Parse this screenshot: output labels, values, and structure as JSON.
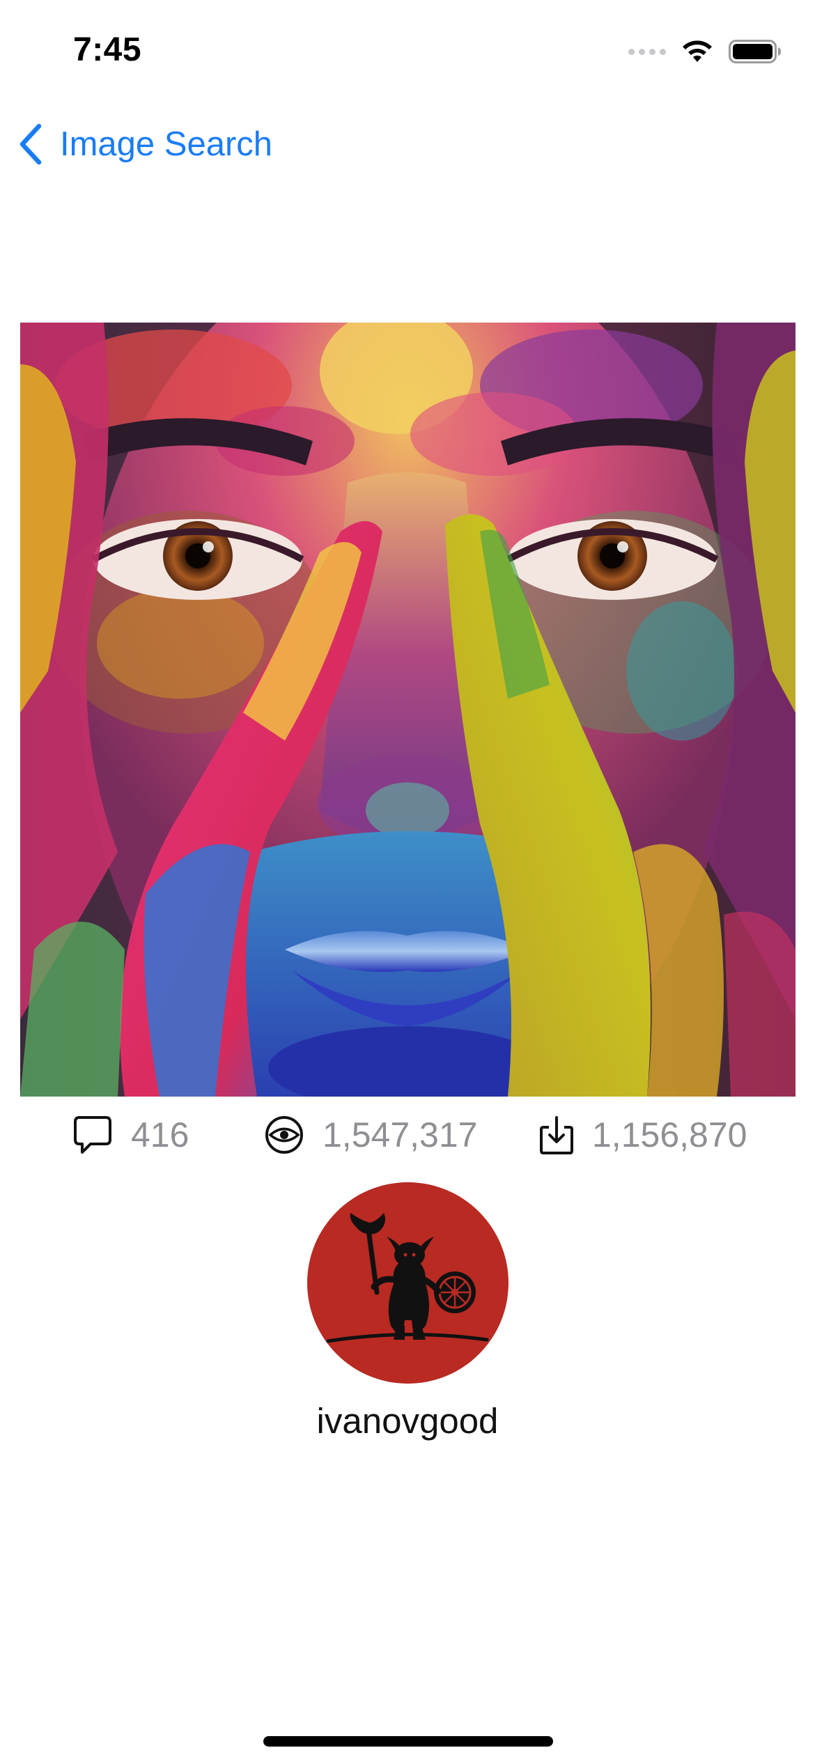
{
  "status_bar": {
    "time": "7:45"
  },
  "nav": {
    "back_label": "Image Search"
  },
  "stats": {
    "comments": "416",
    "views": "1,547,317",
    "downloads": "1,156,870"
  },
  "user": {
    "username": "ivanovgood"
  },
  "colors": {
    "accent": "#1a7cf5",
    "stat_text": "#8e8e93",
    "avatar_bg": "#b82a22"
  },
  "icons": {
    "back": "chevron-left-icon",
    "comments": "speech-bubble-icon",
    "views": "eye-icon",
    "downloads": "download-tray-icon"
  }
}
